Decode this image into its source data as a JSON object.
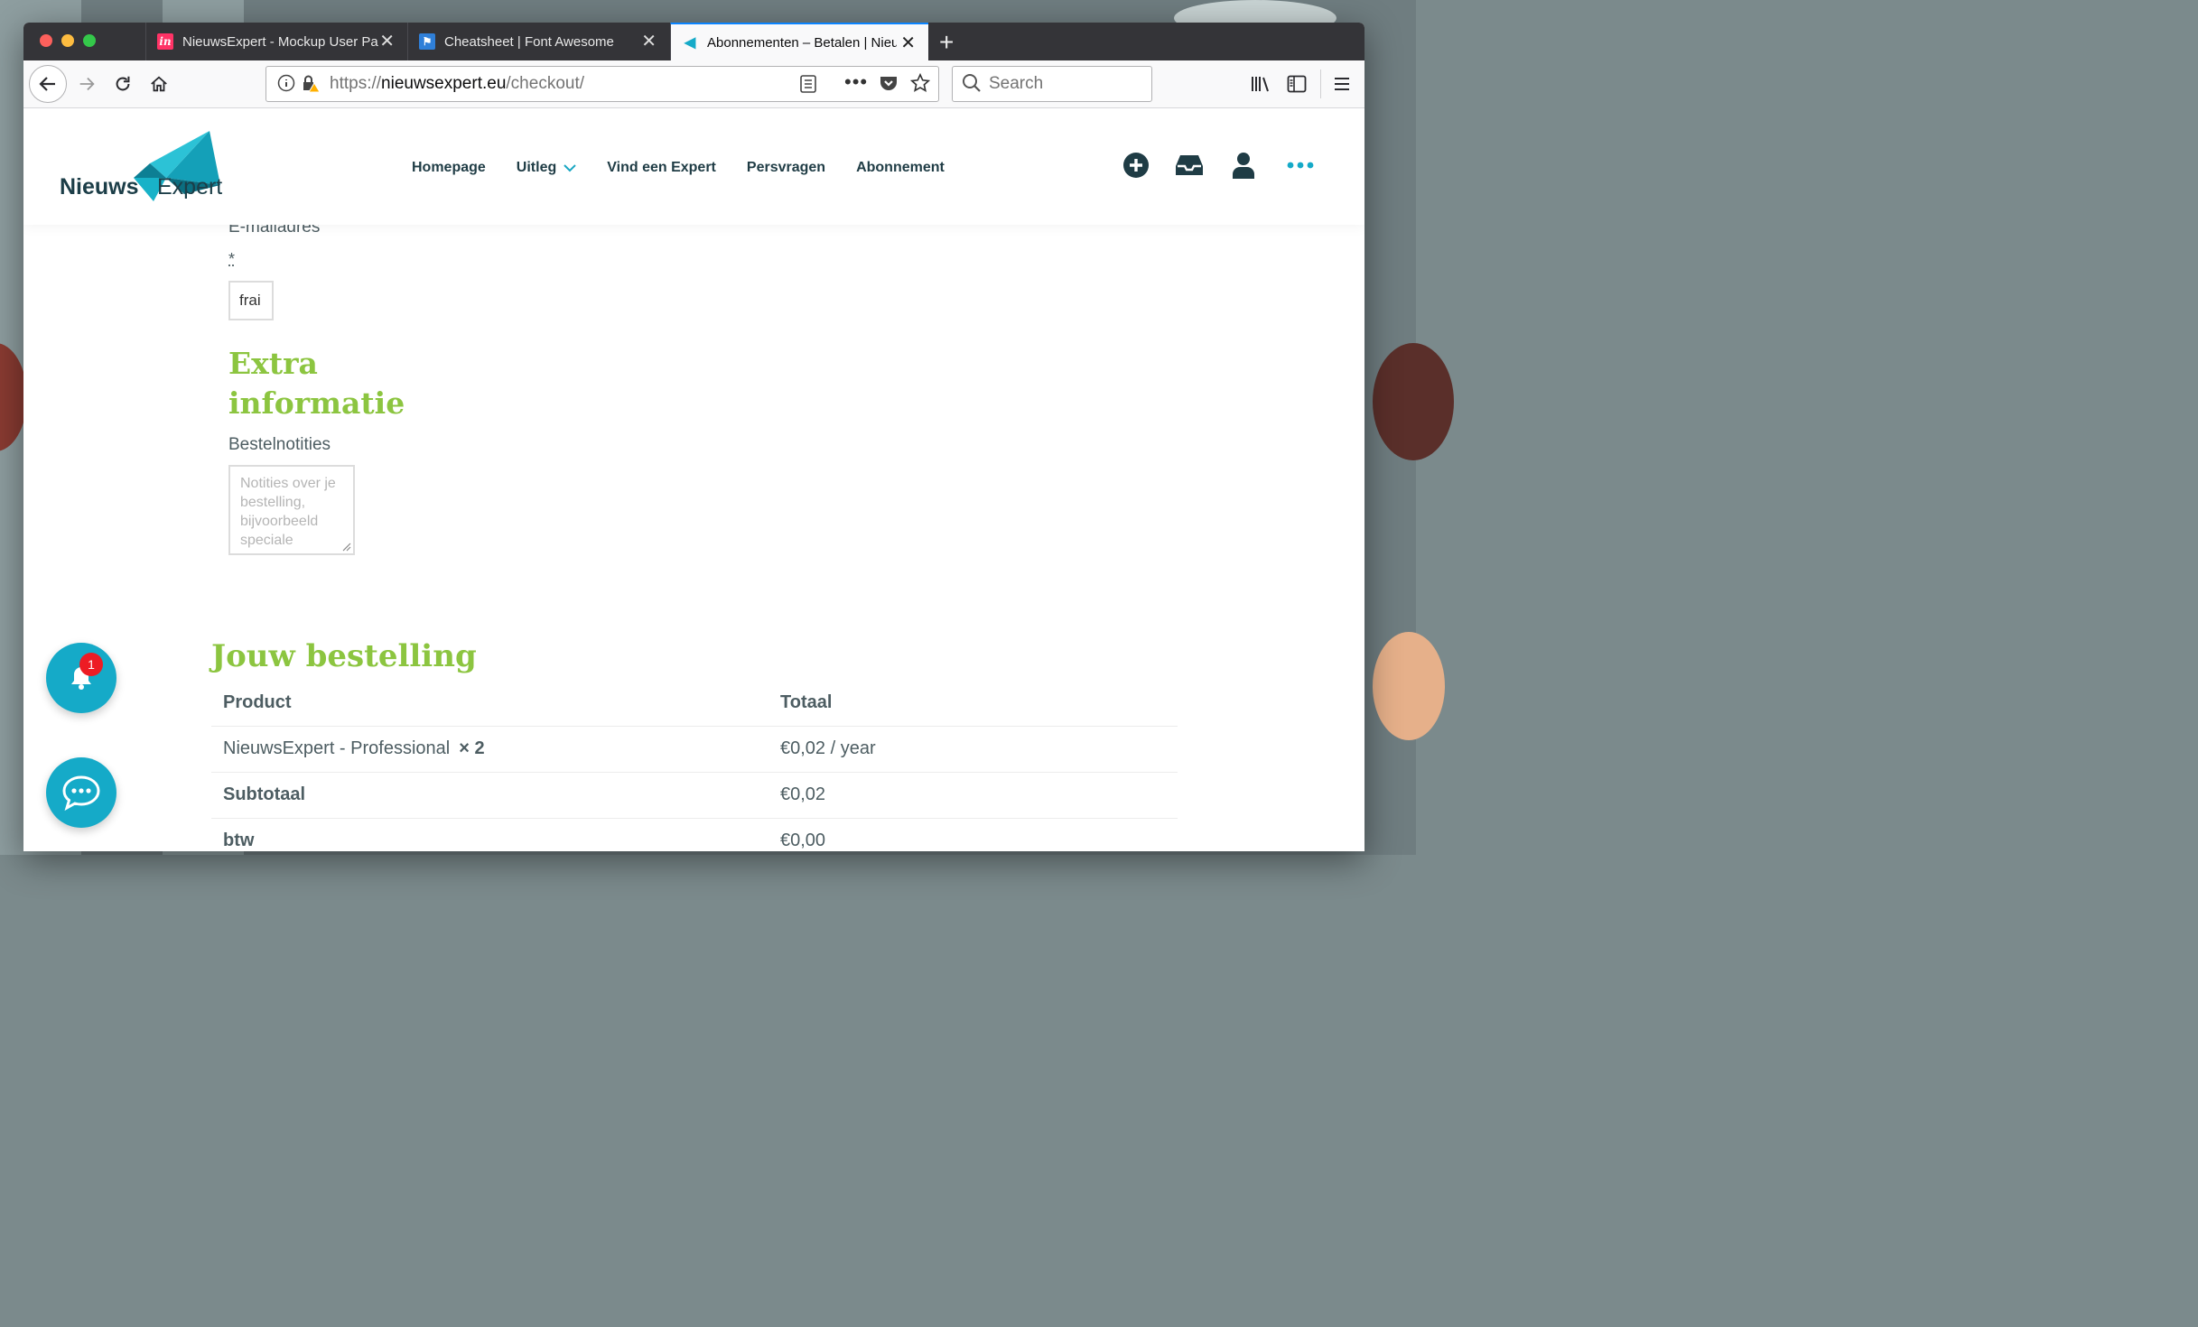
{
  "browser": {
    "tabs": [
      {
        "title": "NieuwsExpert - Mockup User Pa",
        "favicon": "invision-icon",
        "color": "#ff3366"
      },
      {
        "title": "Cheatsheet | Font Awesome",
        "favicon": "flag-icon",
        "color": "#2f7fd8"
      },
      {
        "title": "Abonnementen – Betalen | Nieuw",
        "favicon": "megaphone-icon",
        "color": "#15aac8"
      }
    ],
    "url_scheme": "https://",
    "url_host": "nieuwsexpert.eu",
    "url_path": "/checkout/",
    "search_placeholder": "Search"
  },
  "site": {
    "logo_word1": "Nieuws",
    "logo_word2": "Expert",
    "menu": [
      {
        "label": "Homepage"
      },
      {
        "label": "Uitleg",
        "has_dropdown": true
      },
      {
        "label": "Vind een Expert"
      },
      {
        "label": "Persvragen"
      },
      {
        "label": "Abonnement"
      }
    ],
    "colors": {
      "accent_green": "#8cc540",
      "accent_teal": "#15aac8",
      "dark": "#1f3c45"
    }
  },
  "form": {
    "email_label": "E-mailadres",
    "required_mark": "*",
    "email_value": "frai",
    "extra_title_line1": "Extra",
    "extra_title_line2": "informatie",
    "notes_label": "Bestelnotities",
    "notes_placeholder": "Notities over je bestelling, bijvoorbeeld speciale"
  },
  "order": {
    "title": "Jouw bestelling",
    "col_product": "Product",
    "col_total": "Totaal",
    "item_name": "NieuwsExpert - Professional",
    "item_qty": "× 2",
    "item_total": "€0,02 / year",
    "subtotal_label": "Subtotaal",
    "subtotal_value": "€0,02",
    "tax_label": "btw",
    "tax_value": "€0,00"
  },
  "notifications": {
    "count": "1"
  }
}
